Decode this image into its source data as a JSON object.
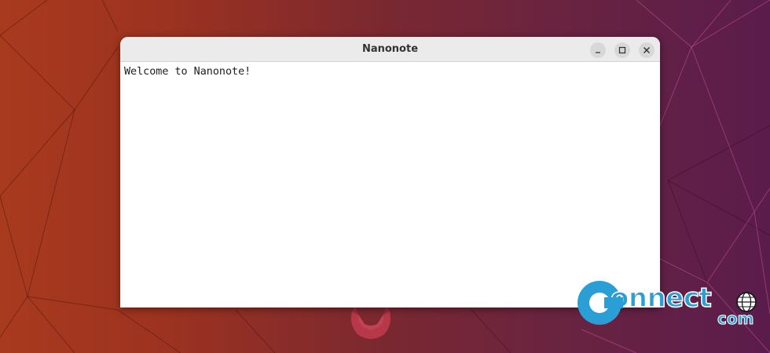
{
  "window": {
    "title": "Nanonote"
  },
  "editor": {
    "content": "Welcome to Nanonote!"
  },
  "watermark": {
    "word": "onnect",
    "domain": "com"
  },
  "icons": {
    "minimize": "minimize-icon",
    "maximize": "maximize-icon",
    "close": "close-icon",
    "globe": "globe-icon"
  },
  "colors": {
    "desktop_left": "#a83a1e",
    "desktop_right": "#5a1c4c",
    "titlebar": "#ebebeb",
    "watermark_blue": "#2a9fd6"
  }
}
